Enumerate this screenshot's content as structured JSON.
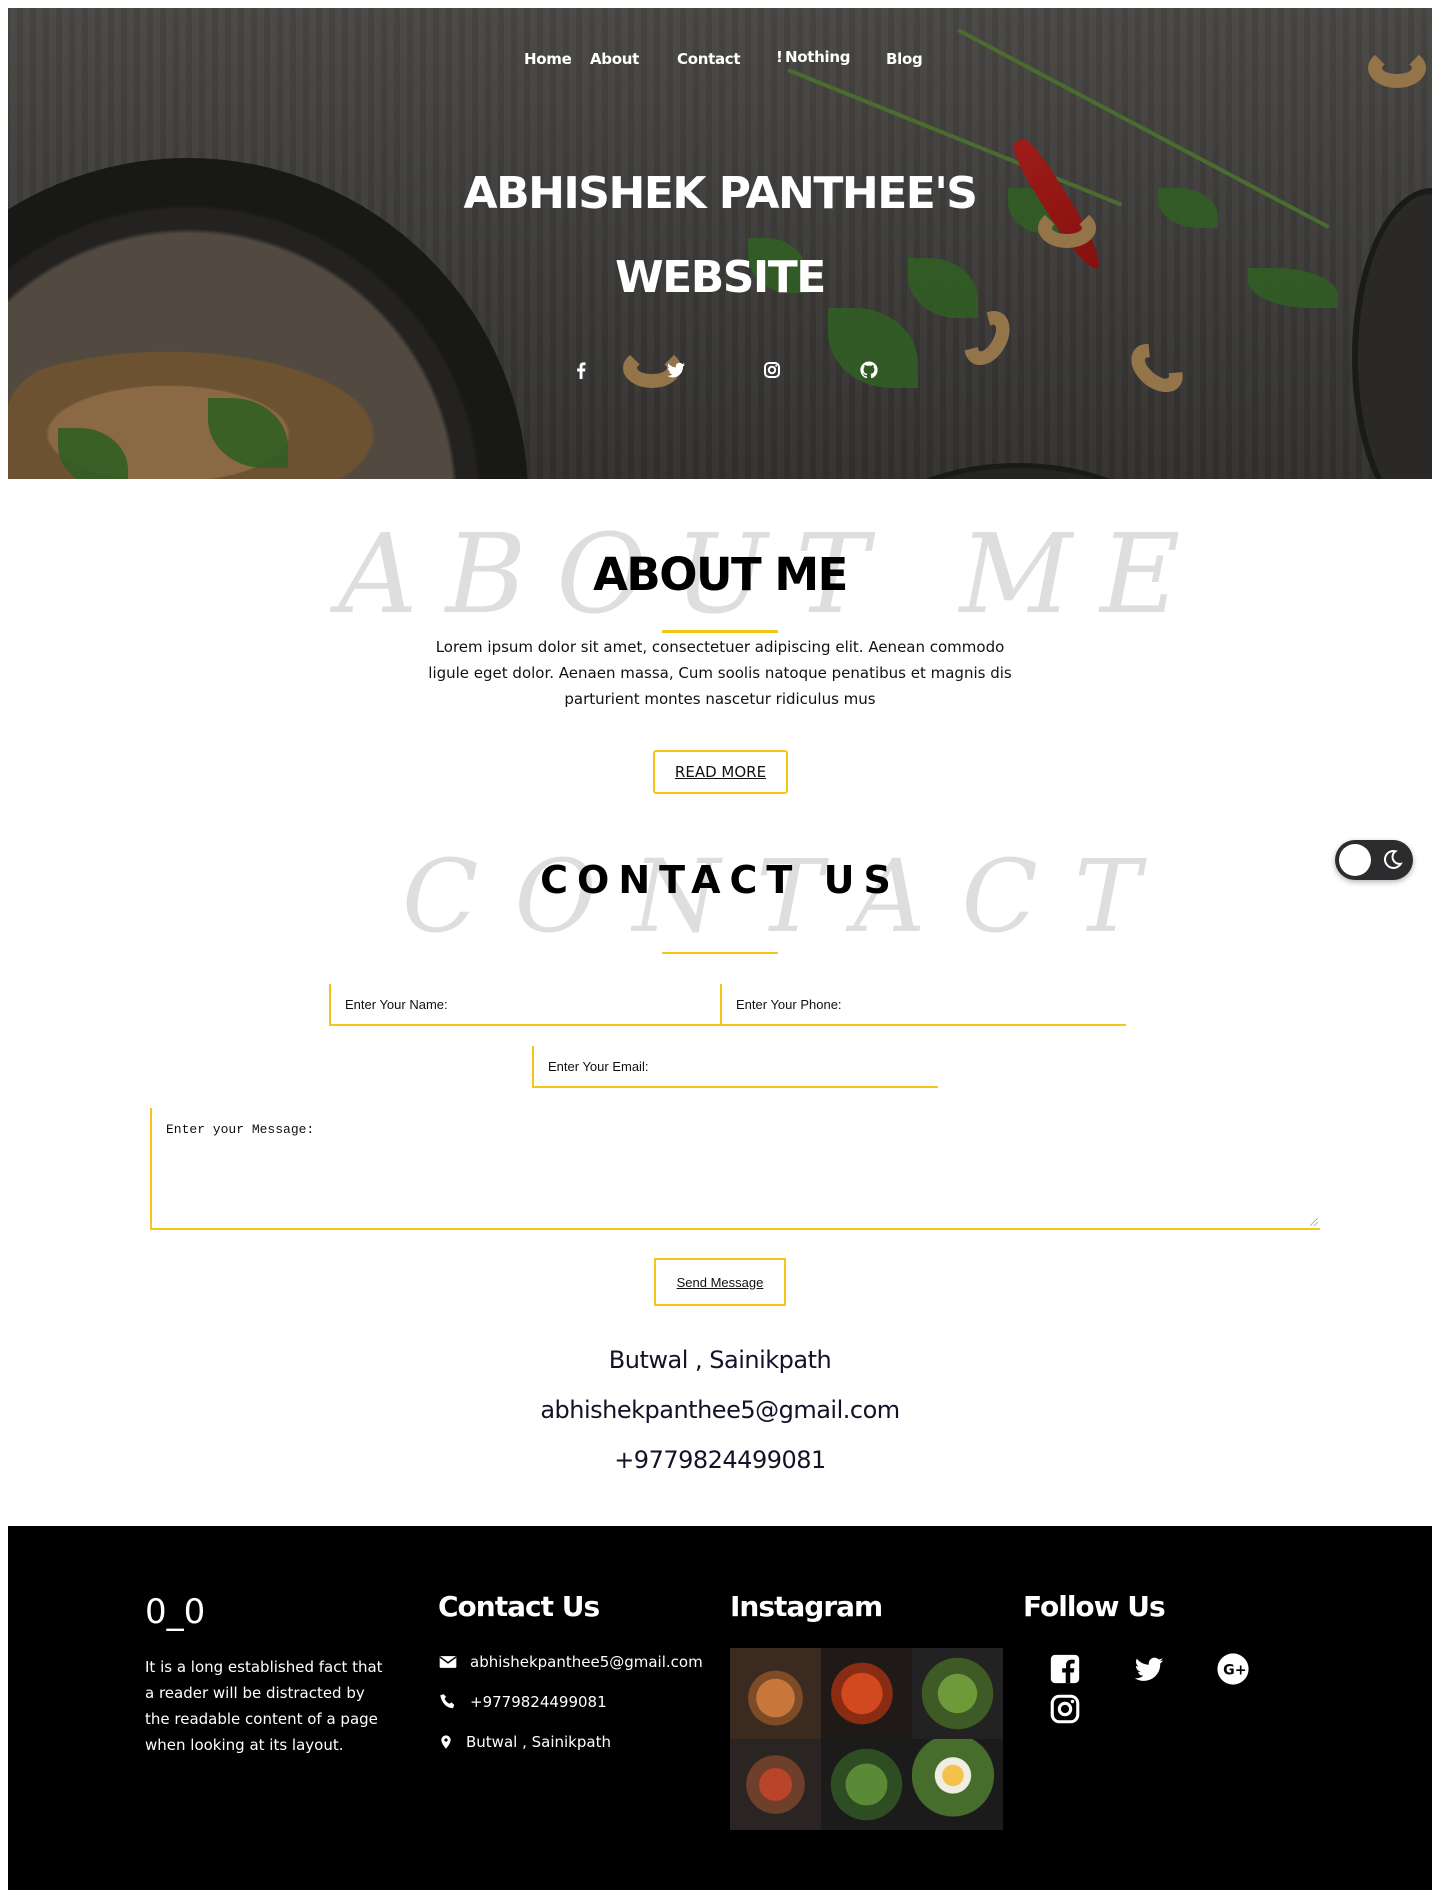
{
  "nav": {
    "items": [
      {
        "label": "Home"
      },
      {
        "label": "About"
      },
      {
        "label": "Contact"
      },
      {
        "label": "Nothing",
        "icon": "exclamation-icon"
      },
      {
        "label": "Blog"
      }
    ]
  },
  "hero": {
    "title_line1": "ABHISHEK PANTHEE'S",
    "title_line2": "WEBSITE",
    "social_icons": [
      "facebook-icon",
      "twitter-icon",
      "instagram-icon",
      "github-icon"
    ]
  },
  "about": {
    "ghost_text": "ABOUT ME",
    "heading": "ABOUT ME",
    "body": "Lorem ipsum dolor sit amet, consectetuer adipiscing elit. Aenean commodo ligule eget dolor. Aenaen massa, Cum soolis natoque penatibus et magnis dis parturient montes nascetur ridiculus mus",
    "read_more_label": "READ MORE"
  },
  "theme_toggle": {
    "state": "light",
    "icons": [
      "sun-knob",
      "moon-icon"
    ]
  },
  "contact": {
    "ghost_text": "CONTACT",
    "heading": "CONTACT US",
    "name_placeholder": "Enter Your Name:",
    "phone_placeholder": "Enter Your Phone:",
    "email_placeholder": "Enter Your Email:",
    "message_placeholder": "Enter your Message:",
    "send_label": "Send Message",
    "address": "Butwal , Sainikpath",
    "email": "abhishekpanthee5@gmail.com",
    "phone": "+9779824499081"
  },
  "footer": {
    "logo": "0_0",
    "about_text": "It is a long established fact that a reader will be distracted by the readable content of a page when looking at its layout.",
    "contact_heading": "Contact Us",
    "contact_email": "abhishekpanthee5@gmail.com",
    "contact_phone": "+9779824499081",
    "contact_address": "Butwal , Sainikpath",
    "instagram_heading": "Instagram",
    "follow_heading": "Follow Us",
    "follow_icons": [
      "facebook-square-icon",
      "twitter-icon",
      "google-plus-icon",
      "instagram-icon"
    ]
  },
  "colors": {
    "accent": "#f5c518",
    "footer_bg": "#000000",
    "text_dark": "#141226"
  }
}
